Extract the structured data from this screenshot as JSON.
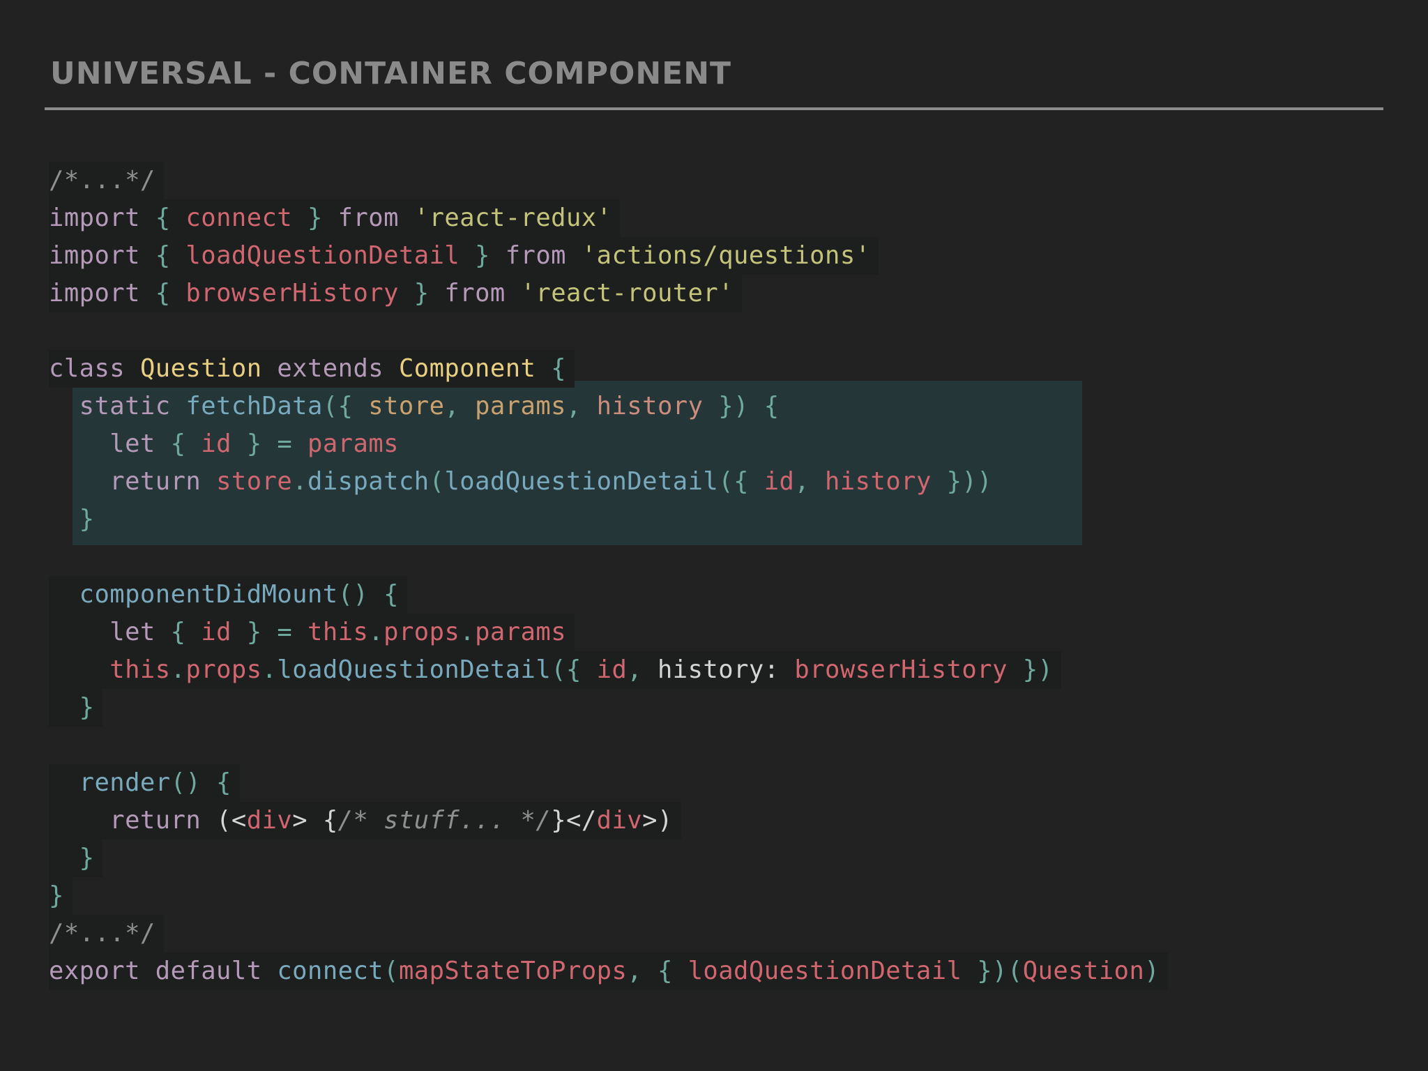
{
  "slide": {
    "title": "UNIVERSAL - CONTAINER COMPONENT"
  },
  "code_lines": [
    [
      {
        "t": "/*...*/",
        "c": "comment"
      }
    ],
    [
      {
        "t": "import ",
        "c": "kw"
      },
      {
        "t": "{ ",
        "c": "punct"
      },
      {
        "t": "connect",
        "c": "var"
      },
      {
        "t": " } ",
        "c": "punct"
      },
      {
        "t": "from ",
        "c": "kw"
      },
      {
        "t": "'react-redux'",
        "c": "str"
      }
    ],
    [
      {
        "t": "import ",
        "c": "kw"
      },
      {
        "t": "{ ",
        "c": "punct"
      },
      {
        "t": "loadQuestionDetail",
        "c": "var"
      },
      {
        "t": " } ",
        "c": "punct"
      },
      {
        "t": "from ",
        "c": "kw"
      },
      {
        "t": "'actions/questions'",
        "c": "str"
      }
    ],
    [
      {
        "t": "import ",
        "c": "kw"
      },
      {
        "t": "{ ",
        "c": "punct"
      },
      {
        "t": "browserHistory",
        "c": "var"
      },
      {
        "t": " } ",
        "c": "punct"
      },
      {
        "t": "from ",
        "c": "kw"
      },
      {
        "t": "'react-router'",
        "c": "str"
      }
    ],
    [
      {
        "t": "",
        "c": "plain"
      }
    ],
    [
      {
        "t": "class ",
        "c": "kw"
      },
      {
        "t": "Question ",
        "c": "class"
      },
      {
        "t": "extends ",
        "c": "kw"
      },
      {
        "t": "Component ",
        "c": "class"
      },
      {
        "t": "{",
        "c": "punct"
      }
    ],
    [
      {
        "t": "  static ",
        "c": "kw"
      },
      {
        "t": "fetchData",
        "c": "fn"
      },
      {
        "t": "({ ",
        "c": "punct"
      },
      {
        "t": "store",
        "c": "param"
      },
      {
        "t": ", ",
        "c": "punct"
      },
      {
        "t": "params",
        "c": "param"
      },
      {
        "t": ", ",
        "c": "punct"
      },
      {
        "t": "history",
        "c": "hist"
      },
      {
        "t": " }) {",
        "c": "punct"
      }
    ],
    [
      {
        "t": "    let ",
        "c": "kw"
      },
      {
        "t": "{ ",
        "c": "punct"
      },
      {
        "t": "id",
        "c": "var"
      },
      {
        "t": " } = ",
        "c": "punct"
      },
      {
        "t": "params",
        "c": "var"
      }
    ],
    [
      {
        "t": "    return ",
        "c": "kw"
      },
      {
        "t": "store",
        "c": "var"
      },
      {
        "t": ".",
        "c": "punct"
      },
      {
        "t": "dispatch",
        "c": "fn"
      },
      {
        "t": "(",
        "c": "punct"
      },
      {
        "t": "loadQuestionDetail",
        "c": "fn"
      },
      {
        "t": "({ ",
        "c": "punct"
      },
      {
        "t": "id",
        "c": "var"
      },
      {
        "t": ", ",
        "c": "punct"
      },
      {
        "t": "history",
        "c": "var"
      },
      {
        "t": " }))",
        "c": "punct"
      }
    ],
    [
      {
        "t": "  }",
        "c": "punct"
      }
    ],
    [
      {
        "t": "",
        "c": "plain"
      }
    ],
    [
      {
        "t": "  componentDidMount",
        "c": "fn"
      },
      {
        "t": "() {",
        "c": "punct"
      }
    ],
    [
      {
        "t": "    let ",
        "c": "kw"
      },
      {
        "t": "{ ",
        "c": "punct"
      },
      {
        "t": "id",
        "c": "var"
      },
      {
        "t": " } = ",
        "c": "punct"
      },
      {
        "t": "this",
        "c": "var"
      },
      {
        "t": ".",
        "c": "punct"
      },
      {
        "t": "props",
        "c": "var"
      },
      {
        "t": ".",
        "c": "punct"
      },
      {
        "t": "params",
        "c": "var"
      }
    ],
    [
      {
        "t": "    this",
        "c": "var"
      },
      {
        "t": ".",
        "c": "punct"
      },
      {
        "t": "props",
        "c": "var"
      },
      {
        "t": ".",
        "c": "punct"
      },
      {
        "t": "loadQuestionDetail",
        "c": "fn"
      },
      {
        "t": "({ ",
        "c": "punct"
      },
      {
        "t": "id",
        "c": "var"
      },
      {
        "t": ", ",
        "c": "punct"
      },
      {
        "t": "history: ",
        "c": "plain"
      },
      {
        "t": "browserHistory",
        "c": "var"
      },
      {
        "t": " })",
        "c": "punct"
      }
    ],
    [
      {
        "t": "  }",
        "c": "punct"
      }
    ],
    [
      {
        "t": "",
        "c": "plain"
      }
    ],
    [
      {
        "t": "  render",
        "c": "fn"
      },
      {
        "t": "() {",
        "c": "punct"
      }
    ],
    [
      {
        "t": "    return ",
        "c": "kw"
      },
      {
        "t": "(<",
        "c": "plain"
      },
      {
        "t": "div",
        "c": "var"
      },
      {
        "t": "> {",
        "c": "plain"
      },
      {
        "t": "/* stuff... */",
        "c": "comment-i"
      },
      {
        "t": "}</",
        "c": "plain"
      },
      {
        "t": "div",
        "c": "var"
      },
      {
        "t": ">)",
        "c": "plain"
      }
    ],
    [
      {
        "t": "  }",
        "c": "punct"
      }
    ],
    [
      {
        "t": "}",
        "c": "punct"
      }
    ],
    [
      {
        "t": "/*...*/",
        "c": "comment"
      }
    ],
    [
      {
        "t": "export ",
        "c": "kw"
      },
      {
        "t": "default ",
        "c": "kw"
      },
      {
        "t": "connect",
        "c": "fn"
      },
      {
        "t": "(",
        "c": "punct"
      },
      {
        "t": "mapStateToProps",
        "c": "var"
      },
      {
        "t": ", { ",
        "c": "punct"
      },
      {
        "t": "loadQuestionDetail",
        "c": "var"
      },
      {
        "t": " })(",
        "c": "punct"
      },
      {
        "t": "Question",
        "c": "var"
      },
      {
        "t": ")",
        "c": "punct"
      }
    ]
  ],
  "highlight": {
    "color": "#243638",
    "lines": [
      6,
      7,
      8,
      9
    ]
  }
}
